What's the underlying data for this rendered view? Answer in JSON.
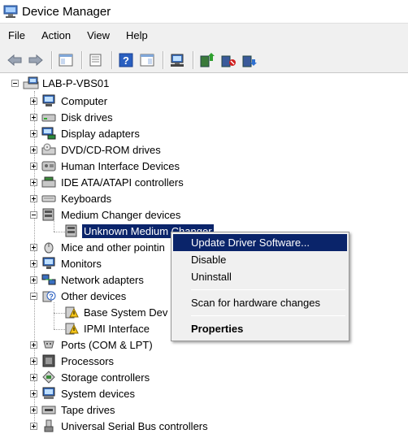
{
  "window": {
    "title": "Device Manager"
  },
  "menu": [
    "File",
    "Action",
    "View",
    "Help"
  ],
  "toolbar": [
    "back-icon",
    "forward-icon",
    "show-hide-tree-icon",
    "properties-icon",
    "help-icon",
    "show-hide-action-pane-icon",
    "scan-hardware-icon",
    "update-driver-icon",
    "disable-device-icon",
    "uninstall-device-icon"
  ],
  "tree": {
    "root": "LAB-P-VBS01",
    "categories": [
      "Computer",
      "Disk drives",
      "Display adapters",
      "DVD/CD-ROM drives",
      "Human Interface Devices",
      "IDE ATA/ATAPI controllers",
      "Keyboards",
      "Medium Changer devices",
      "Unknown Medium Changer",
      "Mice and other pointin",
      "Monitors",
      "Network adapters",
      "Other devices",
      "Base System Dev",
      "IPMI Interface",
      "Ports (COM & LPT)",
      "Processors",
      "Storage controllers",
      "System devices",
      "Tape drives",
      "Universal Serial Bus controllers"
    ]
  },
  "context_menu": {
    "update": "Update Driver Software...",
    "disable": "Disable",
    "uninstall": "Uninstall",
    "scan": "Scan for hardware changes",
    "properties": "Properties"
  },
  "colors": {
    "selection": "#0a246a",
    "chrome": "#f0f0f0"
  }
}
